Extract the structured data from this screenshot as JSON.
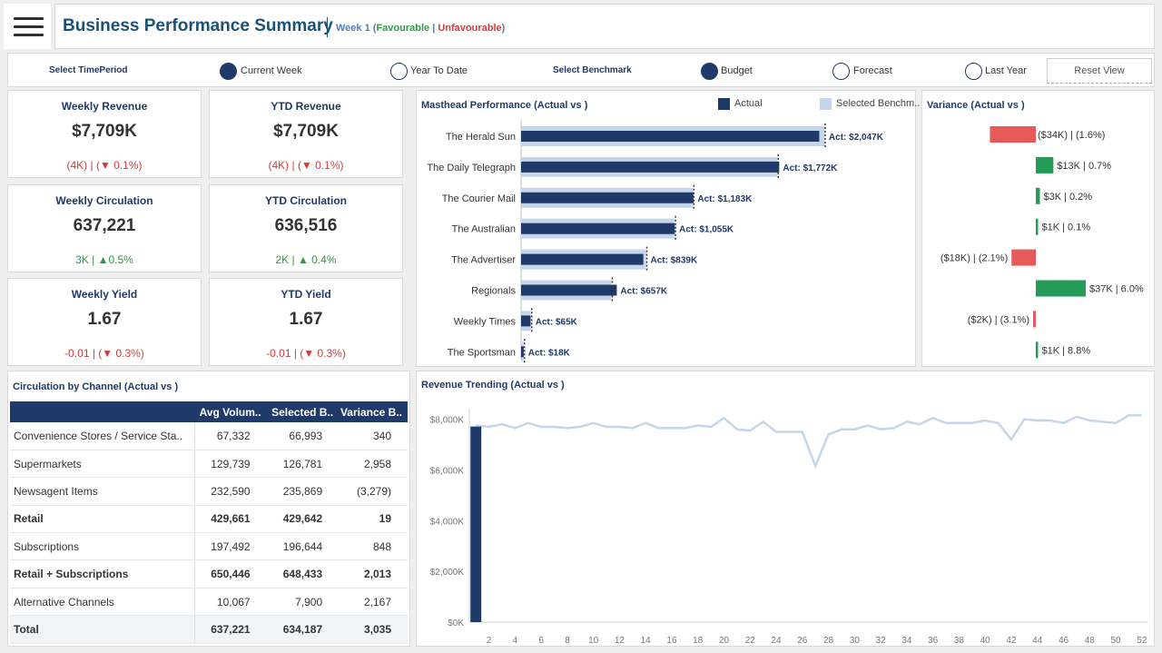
{
  "header": {
    "title": "Business Performance Summary",
    "week_label": "Week 1",
    "open_paren": " (",
    "favourable": "Favourable",
    "pipe": " | ",
    "unfavourable": "Unfavourable",
    "close_paren": ")"
  },
  "filters": {
    "time_label": "Select TimePeriod",
    "time_options": [
      {
        "label": "Current Week",
        "selected": true
      },
      {
        "label": "Year To Date",
        "selected": false
      }
    ],
    "benchmark_label": "Select  Benchmark",
    "benchmark_options": [
      {
        "label": "Budget",
        "selected": true
      },
      {
        "label": "Forecast",
        "selected": false
      },
      {
        "label": "Last Year",
        "selected": false
      }
    ],
    "reset_label": "Reset View"
  },
  "kpis": [
    {
      "label": "Weekly Revenue",
      "value": "$7,709K",
      "variance": "(4K) | (▼ 0.1%)",
      "status": "red"
    },
    {
      "label": "YTD Revenue",
      "value": "$7,709K",
      "variance": "(4K) | (▼ 0.1%)",
      "status": "red"
    },
    {
      "label": "Weekly Circulation",
      "value": "637,221",
      "variance": "3K | ▲0.5%",
      "status": "green"
    },
    {
      "label": "YTD Circulation",
      "value": "636,516",
      "variance": "2K | ▲ 0.4%",
      "status": "green"
    },
    {
      "label": "Weekly Yield",
      "value": "1.67",
      "variance": "-0.01 | (▼ 0.3%)",
      "status": "red"
    },
    {
      "label": "YTD Yield",
      "value": "1.67",
      "variance": "-0.01  | (▼ 0.3%)",
      "status": "red"
    }
  ],
  "masthead": {
    "title": "Masthead Performance (Actual vs )",
    "legend_actual": "Actual",
    "legend_benchmark": "Selected Benchm..",
    "colors": {
      "actual": "#1f3a68",
      "benchmark": "#c5d6ec"
    }
  },
  "variance": {
    "title": "Variance (Actual vs )",
    "colors": {
      "favourable": "#239b56",
      "unfavourable": "#e85a5a"
    }
  },
  "channel": {
    "title": "Circulation by Channel  (Actual vs )",
    "columns": [
      "",
      "Avg Volum..",
      "Selected B..",
      "Variance B.."
    ],
    "rows": [
      {
        "name": "Convenience Stores / Service Sta..",
        "avg": "67,332",
        "bench": "66,993",
        "var": "340",
        "status": "green",
        "bold": false
      },
      {
        "name": "Supermarkets",
        "avg": "129,739",
        "bench": "126,781",
        "var": "2,958",
        "status": "green",
        "bold": false
      },
      {
        "name": "Newsagent Items",
        "avg": "232,590",
        "bench": "235,869",
        "var": "(3,279)",
        "status": "red",
        "bold": false
      },
      {
        "name": "Retail",
        "avg": "429,661",
        "bench": "429,642",
        "var": "19",
        "status": "green",
        "bold": true
      },
      {
        "name": "Subscriptions",
        "avg": "197,492",
        "bench": "196,644",
        "var": "848",
        "status": "green",
        "bold": false
      },
      {
        "name": "Retail + Subscriptions",
        "avg": "650,446",
        "bench": "648,433",
        "var": "2,013",
        "status": "green",
        "bold": true
      },
      {
        "name": "Alternative Channels",
        "avg": "10,067",
        "bench": "7,900",
        "var": "2,167",
        "status": "green",
        "bold": false
      },
      {
        "name": "Total",
        "avg": "637,221",
        "bench": "634,187",
        "var": "3,035",
        "status": "green",
        "bold": true,
        "total": true
      }
    ]
  },
  "trend": {
    "title": "Revenue Trending (Actual vs )"
  },
  "chart_data": [
    {
      "type": "bar",
      "title": "Masthead Performance (Actual vs )",
      "categories": [
        "The Herald Sun",
        "The Daily Telegraph",
        "The Courier Mail",
        "The Australian",
        "The Advertiser",
        "Regionals",
        "Weekly Times",
        "The Sportsman"
      ],
      "series": [
        {
          "name": "Actual",
          "values": [
            2047,
            1772,
            1183,
            1055,
            839,
            657,
            65,
            18
          ]
        },
        {
          "name": "Selected Benchm..",
          "values": [
            2081,
            1759,
            1180,
            1054,
            857,
            620,
            67,
            17
          ]
        }
      ],
      "data_labels": [
        "Act: $2,047K",
        "Act: $1,772K",
        "Act: $1,183K",
        "Act: $1,055K",
        "Act: $839K",
        "Act: $657K",
        "Act: $65K",
        "Act: $18K"
      ],
      "xlim": [
        0,
        2150
      ]
    },
    {
      "type": "bar",
      "title": "Variance (Actual vs )",
      "categories": [
        "The Herald Sun",
        "The Daily Telegraph",
        "The Courier Mail",
        "The Australian",
        "The Advertiser",
        "Regionals",
        "Weekly Times",
        "The Sportsman"
      ],
      "values": [
        -34,
        13,
        3,
        1,
        -18,
        37,
        -2,
        1
      ],
      "labels": [
        "($34K) | (1.6%)",
        "$13K | 0.7%",
        "$3K | 0.2%",
        "$1K | 0.1%",
        "($18K) | (2.1%)",
        "$37K | 6.0%",
        "($2K) | (3.1%)",
        "$1K | 8.8%"
      ]
    },
    {
      "type": "line",
      "title": "Revenue Trending (Actual vs )",
      "x": [
        1,
        2,
        3,
        4,
        5,
        6,
        7,
        8,
        9,
        10,
        11,
        12,
        13,
        14,
        15,
        16,
        17,
        18,
        19,
        20,
        21,
        22,
        23,
        24,
        25,
        26,
        27,
        28,
        29,
        30,
        31,
        32,
        33,
        34,
        35,
        36,
        37,
        38,
        39,
        40,
        41,
        42,
        43,
        44,
        45,
        46,
        47,
        48,
        49,
        50,
        51,
        52
      ],
      "x_ticks": [
        2,
        4,
        6,
        8,
        10,
        12,
        14,
        16,
        18,
        20,
        22,
        24,
        26,
        28,
        30,
        32,
        34,
        36,
        38,
        40,
        42,
        44,
        46,
        48,
        50,
        52
      ],
      "y_ticks": [
        "$0K",
        "$2,000K",
        "$4,000K",
        "$6,000K",
        "$8,000K"
      ],
      "ylim": [
        0,
        8450
      ],
      "series": [
        {
          "name": "Benchmark",
          "values": [
            7750,
            7700,
            7800,
            7650,
            7850,
            7700,
            7700,
            7650,
            7700,
            7850,
            7700,
            7700,
            7650,
            7850,
            7650,
            7650,
            7650,
            7750,
            7700,
            8050,
            7600,
            7550,
            7900,
            7500,
            7500,
            7500,
            6150,
            7400,
            7600,
            7600,
            7750,
            7600,
            7650,
            7900,
            7800,
            8050,
            7850,
            7850,
            7850,
            7950,
            7850,
            7200,
            8000,
            7950,
            7950,
            7850,
            8100,
            7950,
            7900,
            7850,
            8150,
            8150
          ]
        },
        {
          "name": "Actual",
          "bar_week": 1,
          "bar_value": 7709
        }
      ]
    }
  ]
}
